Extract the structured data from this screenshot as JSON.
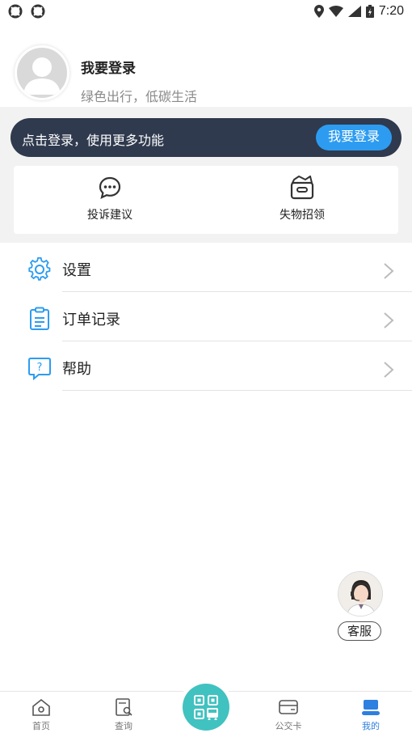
{
  "status_bar": {
    "time": "7:20"
  },
  "profile": {
    "name": "我要登录",
    "subtitle": "绿色出行，低碳生活"
  },
  "login_banner": {
    "text": "点击登录，使用更多功能",
    "button": "我要登录"
  },
  "quick_actions": [
    {
      "label": "投诉建议",
      "icon": "chat-bubble-icon"
    },
    {
      "label": "失物招领",
      "icon": "lost-box-icon"
    }
  ],
  "menu": [
    {
      "label": "设置",
      "icon": "gear-icon"
    },
    {
      "label": "订单记录",
      "icon": "clipboard-icon"
    },
    {
      "label": "帮助",
      "icon": "help-icon"
    }
  ],
  "customer_service": {
    "label": "客服"
  },
  "tabs": [
    {
      "label": "首页",
      "icon": "home-icon"
    },
    {
      "label": "查询",
      "icon": "search-doc-icon"
    },
    {
      "label": "公交卡",
      "icon": "card-icon"
    },
    {
      "label": "我的",
      "icon": "person-icon",
      "active": true
    }
  ],
  "colors": {
    "accent": "#2d9cf0",
    "banner": "#2f3a4e",
    "scan": "#40c2c0",
    "active_tab": "#2d7fe0"
  }
}
